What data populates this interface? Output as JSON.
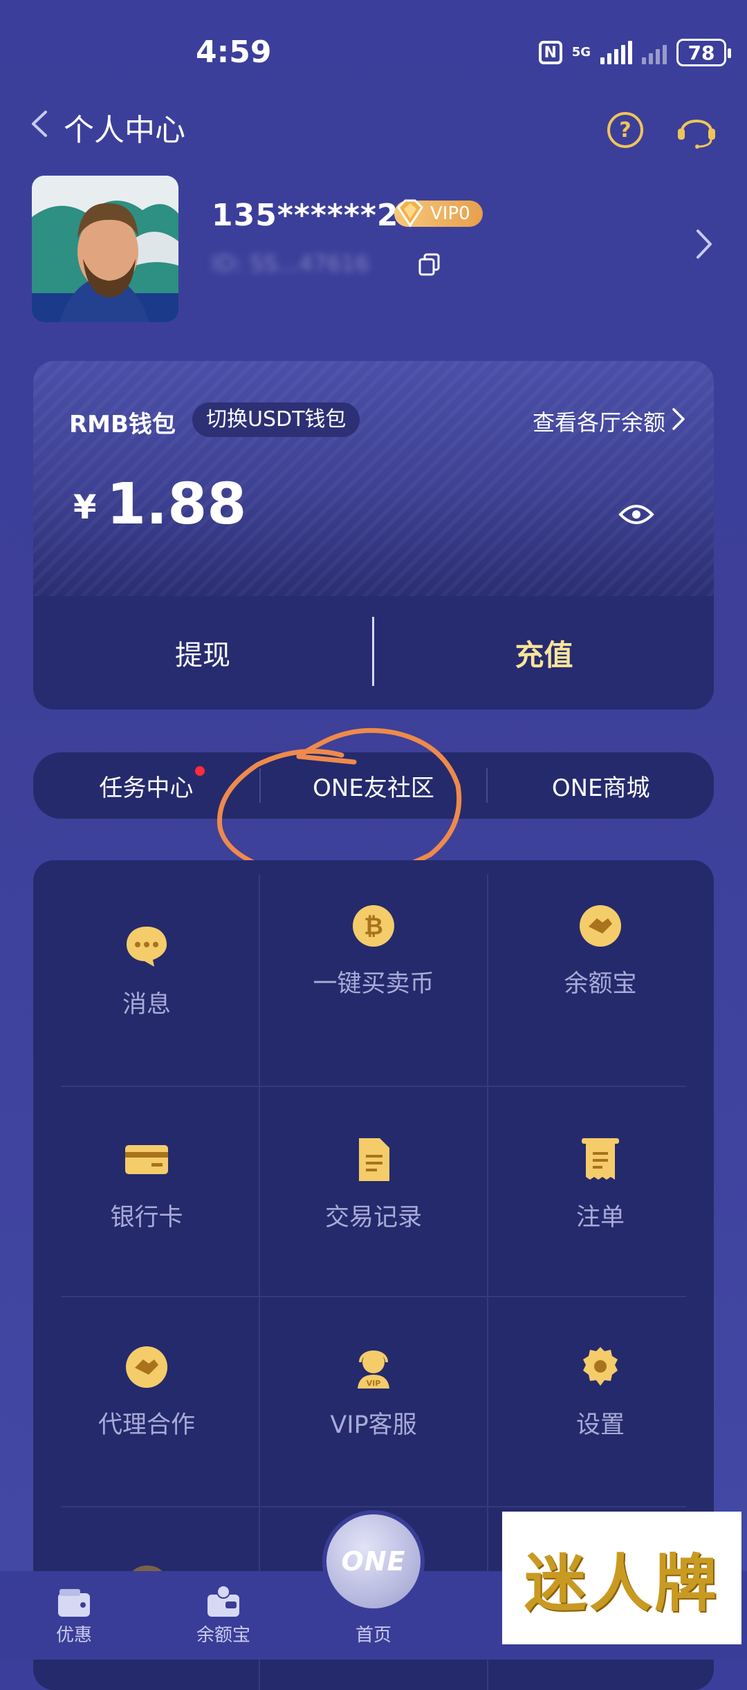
{
  "status_bar": {
    "time": "4:59",
    "network": "5G",
    "battery": "78"
  },
  "header": {
    "title": "个人中心"
  },
  "profile": {
    "phone": "135******27",
    "vip_level": "VIP0",
    "user_id": "ID: SS...47616"
  },
  "wallet": {
    "title": "RMB钱包",
    "switch_label": "切换USDT钱包",
    "view_all_label": "查看各厅余额",
    "currency_symbol": "¥",
    "balance": "1.88",
    "withdraw_label": "提现",
    "deposit_label": "充值"
  },
  "quick_links": [
    {
      "label": "任务中心",
      "has_dot": true
    },
    {
      "label": "ONE友社区",
      "has_dot": false
    },
    {
      "label": "ONE商城",
      "has_dot": false
    }
  ],
  "grid": [
    {
      "label": "消息",
      "icon": "chat-bubble-icon"
    },
    {
      "label": "一键买卖币",
      "icon": "bitcoin-icon"
    },
    {
      "label": "余额宝",
      "icon": "handshake-icon"
    },
    {
      "label": "银行卡",
      "icon": "bank-card-icon"
    },
    {
      "label": "交易记录",
      "icon": "document-icon"
    },
    {
      "label": "注单",
      "icon": "receipt-icon"
    },
    {
      "label": "代理合作",
      "icon": "handshake-icon"
    },
    {
      "label": "VIP客服",
      "icon": "vip-support-icon"
    },
    {
      "label": "设置",
      "icon": "gear-icon"
    }
  ],
  "bottom_nav": {
    "items": [
      {
        "label": "优惠",
        "icon": "wallet-gift-icon"
      },
      {
        "label": "余额宝",
        "icon": "wallet-icon"
      },
      {
        "label": "首页",
        "icon": "home-logo"
      }
    ],
    "home_logo_text": "ONE"
  },
  "watermark": {
    "text": "迷人牌"
  },
  "colors": {
    "accent_gold": "#f8e49a",
    "background": "#3d3f98",
    "card": "#252a6c",
    "annotation": "#ee8a4c"
  }
}
